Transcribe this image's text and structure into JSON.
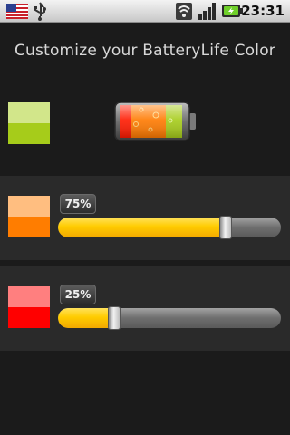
{
  "status_bar": {
    "time": "23:31",
    "icons": [
      "us-flag-icon",
      "usb-icon",
      "wifi-icon",
      "signal-icon",
      "battery-charging-icon"
    ]
  },
  "title": "Customize your BatteryLife Color",
  "preview": {
    "swatch_top": "#d2e68a",
    "swatch_bottom": "#a6cc1a",
    "battery_icon": "battery-preview-icon"
  },
  "sliders": [
    {
      "percent_label": "75%",
      "value": 0.75,
      "swatch_top": "#ffbe80",
      "swatch_bottom": "#ff7d00"
    },
    {
      "percent_label": "25%",
      "value": 0.25,
      "swatch_top": "#ff7f7f",
      "swatch_bottom": "#ff0000"
    }
  ],
  "colors": {
    "background": "#1b1b1b",
    "panel": "#2a2a2a",
    "slider_fill": "#ffcc00"
  }
}
